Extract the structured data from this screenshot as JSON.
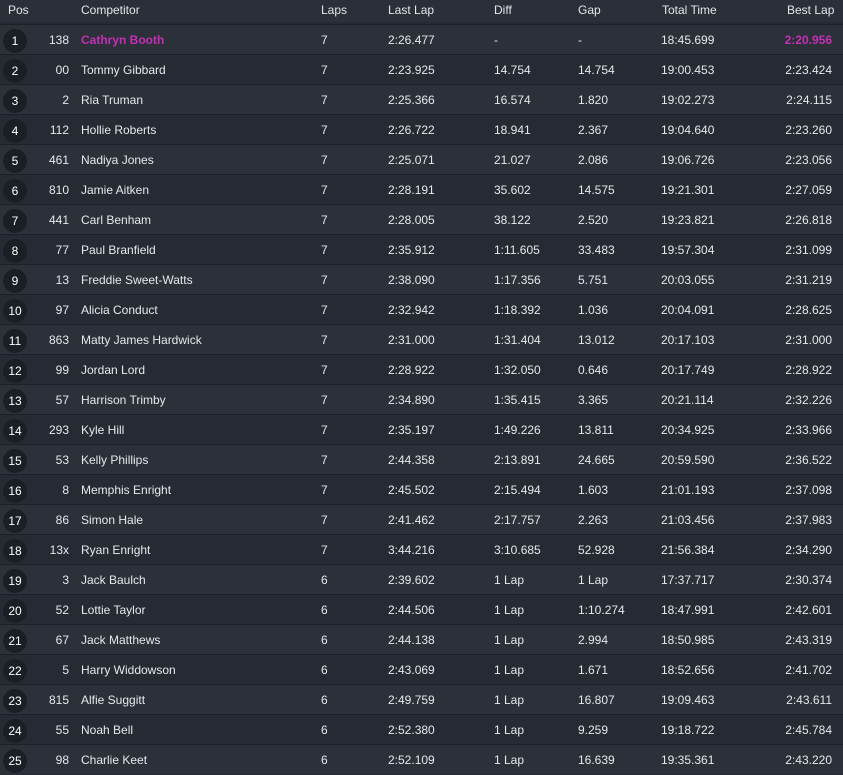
{
  "headers": {
    "pos": "Pos",
    "competitor": "Competitor",
    "laps": "Laps",
    "last_lap": "Last Lap",
    "diff": "Diff",
    "gap": "Gap",
    "total_time": "Total Time",
    "best_lap": "Best Lap"
  },
  "colors": {
    "highlight": "#c42fb6",
    "row_a": "#2b3039",
    "row_b": "#262b33",
    "badge": "#1a1e25"
  },
  "rows": [
    {
      "pos": "1",
      "num": "138",
      "name": "Cathryn Booth",
      "laps": "7",
      "last": "2:26.477",
      "diff": "-",
      "gap": "-",
      "total": "18:45.699",
      "best": "2:20.956",
      "highlight": true
    },
    {
      "pos": "2",
      "num": "00",
      "name": "Tommy Gibbard",
      "laps": "7",
      "last": "2:23.925",
      "diff": "14.754",
      "gap": "14.754",
      "total": "19:00.453",
      "best": "2:23.424"
    },
    {
      "pos": "3",
      "num": "2",
      "name": "Ria Truman",
      "laps": "7",
      "last": "2:25.366",
      "diff": "16.574",
      "gap": "1.820",
      "total": "19:02.273",
      "best": "2:24.115"
    },
    {
      "pos": "4",
      "num": "112",
      "name": "Hollie Roberts",
      "laps": "7",
      "last": "2:26.722",
      "diff": "18.941",
      "gap": "2.367",
      "total": "19:04.640",
      "best": "2:23.260"
    },
    {
      "pos": "5",
      "num": "461",
      "name": "Nadiya Jones",
      "laps": "7",
      "last": "2:25.071",
      "diff": "21.027",
      "gap": "2.086",
      "total": "19:06.726",
      "best": "2:23.056"
    },
    {
      "pos": "6",
      "num": "810",
      "name": "Jamie Aitken",
      "laps": "7",
      "last": "2:28.191",
      "diff": "35.602",
      "gap": "14.575",
      "total": "19:21.301",
      "best": "2:27.059"
    },
    {
      "pos": "7",
      "num": "441",
      "name": "Carl Benham",
      "laps": "7",
      "last": "2:28.005",
      "diff": "38.122",
      "gap": "2.520",
      "total": "19:23.821",
      "best": "2:26.818"
    },
    {
      "pos": "8",
      "num": "77",
      "name": "Paul Branfield",
      "laps": "7",
      "last": "2:35.912",
      "diff": "1:11.605",
      "gap": "33.483",
      "total": "19:57.304",
      "best": "2:31.099"
    },
    {
      "pos": "9",
      "num": "13",
      "name": "Freddie Sweet-Watts",
      "laps": "7",
      "last": "2:38.090",
      "diff": "1:17.356",
      "gap": "5.751",
      "total": "20:03.055",
      "best": "2:31.219"
    },
    {
      "pos": "10",
      "num": "97",
      "name": "Alicia Conduct",
      "laps": "7",
      "last": "2:32.942",
      "diff": "1:18.392",
      "gap": "1.036",
      "total": "20:04.091",
      "best": "2:28.625"
    },
    {
      "pos": "11",
      "num": "863",
      "name": "Matty James Hardwick",
      "laps": "7",
      "last": "2:31.000",
      "diff": "1:31.404",
      "gap": "13.012",
      "total": "20:17.103",
      "best": "2:31.000"
    },
    {
      "pos": "12",
      "num": "99",
      "name": "Jordan Lord",
      "laps": "7",
      "last": "2:28.922",
      "diff": "1:32.050",
      "gap": "0.646",
      "total": "20:17.749",
      "best": "2:28.922"
    },
    {
      "pos": "13",
      "num": "57",
      "name": "Harrison Trimby",
      "laps": "7",
      "last": "2:34.890",
      "diff": "1:35.415",
      "gap": "3.365",
      "total": "20:21.114",
      "best": "2:32.226"
    },
    {
      "pos": "14",
      "num": "293",
      "name": "Kyle Hill",
      "laps": "7",
      "last": "2:35.197",
      "diff": "1:49.226",
      "gap": "13.811",
      "total": "20:34.925",
      "best": "2:33.966"
    },
    {
      "pos": "15",
      "num": "53",
      "name": "Kelly Phillips",
      "laps": "7",
      "last": "2:44.358",
      "diff": "2:13.891",
      "gap": "24.665",
      "total": "20:59.590",
      "best": "2:36.522"
    },
    {
      "pos": "16",
      "num": "8",
      "name": "Memphis Enright",
      "laps": "7",
      "last": "2:45.502",
      "diff": "2:15.494",
      "gap": "1.603",
      "total": "21:01.193",
      "best": "2:37.098"
    },
    {
      "pos": "17",
      "num": "86",
      "name": "Simon Hale",
      "laps": "7",
      "last": "2:41.462",
      "diff": "2:17.757",
      "gap": "2.263",
      "total": "21:03.456",
      "best": "2:37.983"
    },
    {
      "pos": "18",
      "num": "13x",
      "name": "Ryan Enright",
      "laps": "7",
      "last": "3:44.216",
      "diff": "3:10.685",
      "gap": "52.928",
      "total": "21:56.384",
      "best": "2:34.290"
    },
    {
      "pos": "19",
      "num": "3",
      "name": "Jack Baulch",
      "laps": "6",
      "last": "2:39.602",
      "diff": "1 Lap",
      "gap": "1 Lap",
      "total": "17:37.717",
      "best": "2:30.374"
    },
    {
      "pos": "20",
      "num": "52",
      "name": "Lottie Taylor",
      "laps": "6",
      "last": "2:44.506",
      "diff": "1 Lap",
      "gap": "1:10.274",
      "total": "18:47.991",
      "best": "2:42.601"
    },
    {
      "pos": "21",
      "num": "67",
      "name": "Jack Matthews",
      "laps": "6",
      "last": "2:44.138",
      "diff": "1 Lap",
      "gap": "2.994",
      "total": "18:50.985",
      "best": "2:43.319"
    },
    {
      "pos": "22",
      "num": "5",
      "name": "Harry Widdowson",
      "laps": "6",
      "last": "2:43.069",
      "diff": "1 Lap",
      "gap": "1.671",
      "total": "18:52.656",
      "best": "2:41.702"
    },
    {
      "pos": "23",
      "num": "815",
      "name": "Alfie Suggitt",
      "laps": "6",
      "last": "2:49.759",
      "diff": "1 Lap",
      "gap": "16.807",
      "total": "19:09.463",
      "best": "2:43.611"
    },
    {
      "pos": "24",
      "num": "55",
      "name": "Noah Bell",
      "laps": "6",
      "last": "2:52.380",
      "diff": "1 Lap",
      "gap": "9.259",
      "total": "19:18.722",
      "best": "2:45.784"
    },
    {
      "pos": "25",
      "num": "98",
      "name": "Charlie Keet",
      "laps": "6",
      "last": "2:52.109",
      "diff": "1 Lap",
      "gap": "16.639",
      "total": "19:35.361",
      "best": "2:43.220"
    }
  ]
}
